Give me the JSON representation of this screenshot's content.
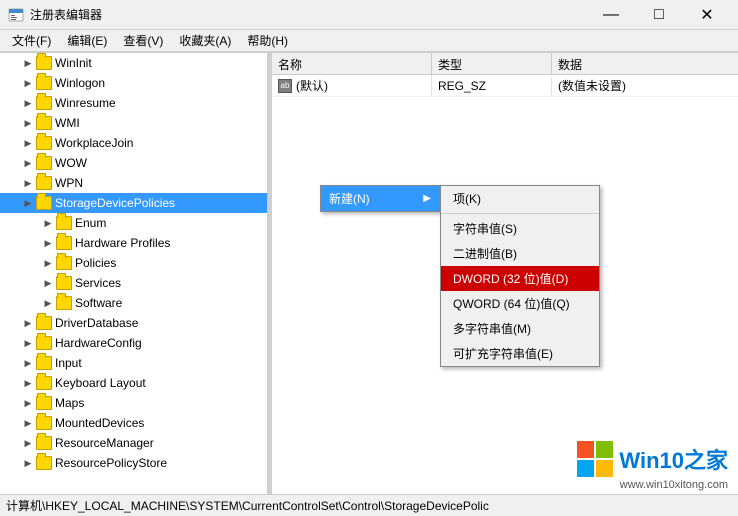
{
  "titleBar": {
    "icon": "regedit",
    "title": "注册表编辑器",
    "minBtn": "—",
    "maxBtn": "□",
    "closeBtn": "✕"
  },
  "menuBar": {
    "items": [
      "文件(F)",
      "编辑(E)",
      "查看(V)",
      "收藏夹(A)",
      "帮助(H)"
    ]
  },
  "treeItems": [
    {
      "indent": 1,
      "expanded": false,
      "label": "WinInit"
    },
    {
      "indent": 1,
      "expanded": false,
      "label": "Winlogon"
    },
    {
      "indent": 1,
      "expanded": false,
      "label": "Winresume"
    },
    {
      "indent": 1,
      "expanded": false,
      "label": "WMI"
    },
    {
      "indent": 1,
      "expanded": false,
      "label": "WorkplaceJoin"
    },
    {
      "indent": 1,
      "expanded": false,
      "label": "WOW"
    },
    {
      "indent": 1,
      "expanded": false,
      "label": "WPN"
    },
    {
      "indent": 1,
      "expanded": false,
      "label": "StorageDevicePolicies",
      "selected": true
    },
    {
      "indent": 2,
      "expanded": false,
      "label": "Enum"
    },
    {
      "indent": 2,
      "expanded": false,
      "label": "Hardware Profiles"
    },
    {
      "indent": 2,
      "expanded": false,
      "label": "Policies"
    },
    {
      "indent": 2,
      "expanded": false,
      "label": "Services"
    },
    {
      "indent": 2,
      "expanded": false,
      "label": "Software"
    },
    {
      "indent": 1,
      "expanded": false,
      "label": "DriverDatabase"
    },
    {
      "indent": 1,
      "expanded": false,
      "label": "HardwareConfig"
    },
    {
      "indent": 1,
      "expanded": false,
      "label": "Input"
    },
    {
      "indent": 1,
      "expanded": false,
      "label": "Keyboard Layout"
    },
    {
      "indent": 1,
      "expanded": false,
      "label": "Maps"
    },
    {
      "indent": 1,
      "expanded": false,
      "label": "MountedDevices"
    },
    {
      "indent": 1,
      "expanded": false,
      "label": "ResourceManager"
    },
    {
      "indent": 1,
      "expanded": false,
      "label": "ResourcePolicyStore"
    }
  ],
  "tableHeaders": {
    "name": "名称",
    "type": "类型",
    "data": "数据"
  },
  "tableRows": [
    {
      "name": "(默认)",
      "type": "REG_SZ",
      "data": "(数值未设置)",
      "icon": "ab"
    }
  ],
  "contextMenu": {
    "newLabel": "新建(N)",
    "arrow": "▶",
    "submenuItems": [
      {
        "label": "项(K)",
        "dividerAfter": false
      },
      {
        "label": "",
        "divider": true
      },
      {
        "label": "字符串值(S)",
        "dividerAfter": false
      },
      {
        "label": "二进制值(B)",
        "dividerAfter": false
      },
      {
        "label": "DWORD (32 位)值(D)",
        "highlighted": true
      },
      {
        "label": "QWORD (64 位)值(Q)",
        "dividerAfter": false
      },
      {
        "label": "多字符串值(M)",
        "dividerAfter": false
      },
      {
        "label": "可扩充字符串值(E)",
        "dividerAfter": false
      }
    ]
  },
  "statusBar": {
    "path": "计算机\\HKEY_LOCAL_MACHINE\\SYSTEM\\CurrentControlSet\\Control\\StorageDevicePolic"
  },
  "watermark": {
    "text1": "Win10",
    "textAccent": "之家",
    "url": "www.win10xitong.com"
  }
}
